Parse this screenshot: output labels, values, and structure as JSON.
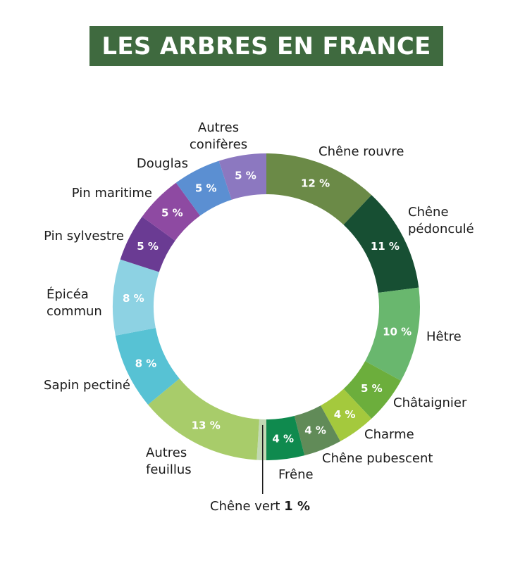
{
  "title": "LES ARBRES EN FRANCE",
  "chart_data": {
    "type": "pie",
    "title": "LES ARBRES EN FRANCE",
    "unit": "%",
    "slices": [
      {
        "label": "Chêne rouvre",
        "value": 12,
        "value_label": "12 %",
        "color": "#6b8a47"
      },
      {
        "label": "Chêne pédonculé",
        "value": 11,
        "value_label": "11 %",
        "color": "#174f33"
      },
      {
        "label": "Hêtre",
        "value": 10,
        "value_label": "10 %",
        "color": "#69b76e"
      },
      {
        "label": "Châtaignier",
        "value": 5,
        "value_label": "5 %",
        "color": "#6cae3c"
      },
      {
        "label": "Charme",
        "value": 4,
        "value_label": "4 %",
        "color": "#a4c93d"
      },
      {
        "label": "Chêne pubescent",
        "value": 4,
        "value_label": "4 %",
        "color": "#618b58"
      },
      {
        "label": "Frêne",
        "value": 4,
        "value_label": "4 %",
        "color": "#0f8a4e"
      },
      {
        "label": "Chêne vert",
        "value": 1,
        "value_label": "1 %",
        "color": "#c2d9b4"
      },
      {
        "label": "Autres feuillus",
        "value": 13,
        "value_label": "13 %",
        "color": "#a8cc6a"
      },
      {
        "label": "Sapin pectiné",
        "value": 8,
        "value_label": "8 %",
        "color": "#57c2d4"
      },
      {
        "label": "Épicéa commun",
        "value": 8,
        "value_label": "8 %",
        "color": "#8dd2e3"
      },
      {
        "label": "Pin sylvestre",
        "value": 5,
        "value_label": "5 %",
        "color": "#6a3b93"
      },
      {
        "label": "Pin maritime",
        "value": 5,
        "value_label": "5 %",
        "color": "#8e4aa2"
      },
      {
        "label": "Douglas",
        "value": 5,
        "value_label": "5 %",
        "color": "#5b8fd2"
      },
      {
        "label": "Autres conifères",
        "value": 5,
        "value_label": "5 %",
        "color": "#8c78c0"
      }
    ]
  }
}
